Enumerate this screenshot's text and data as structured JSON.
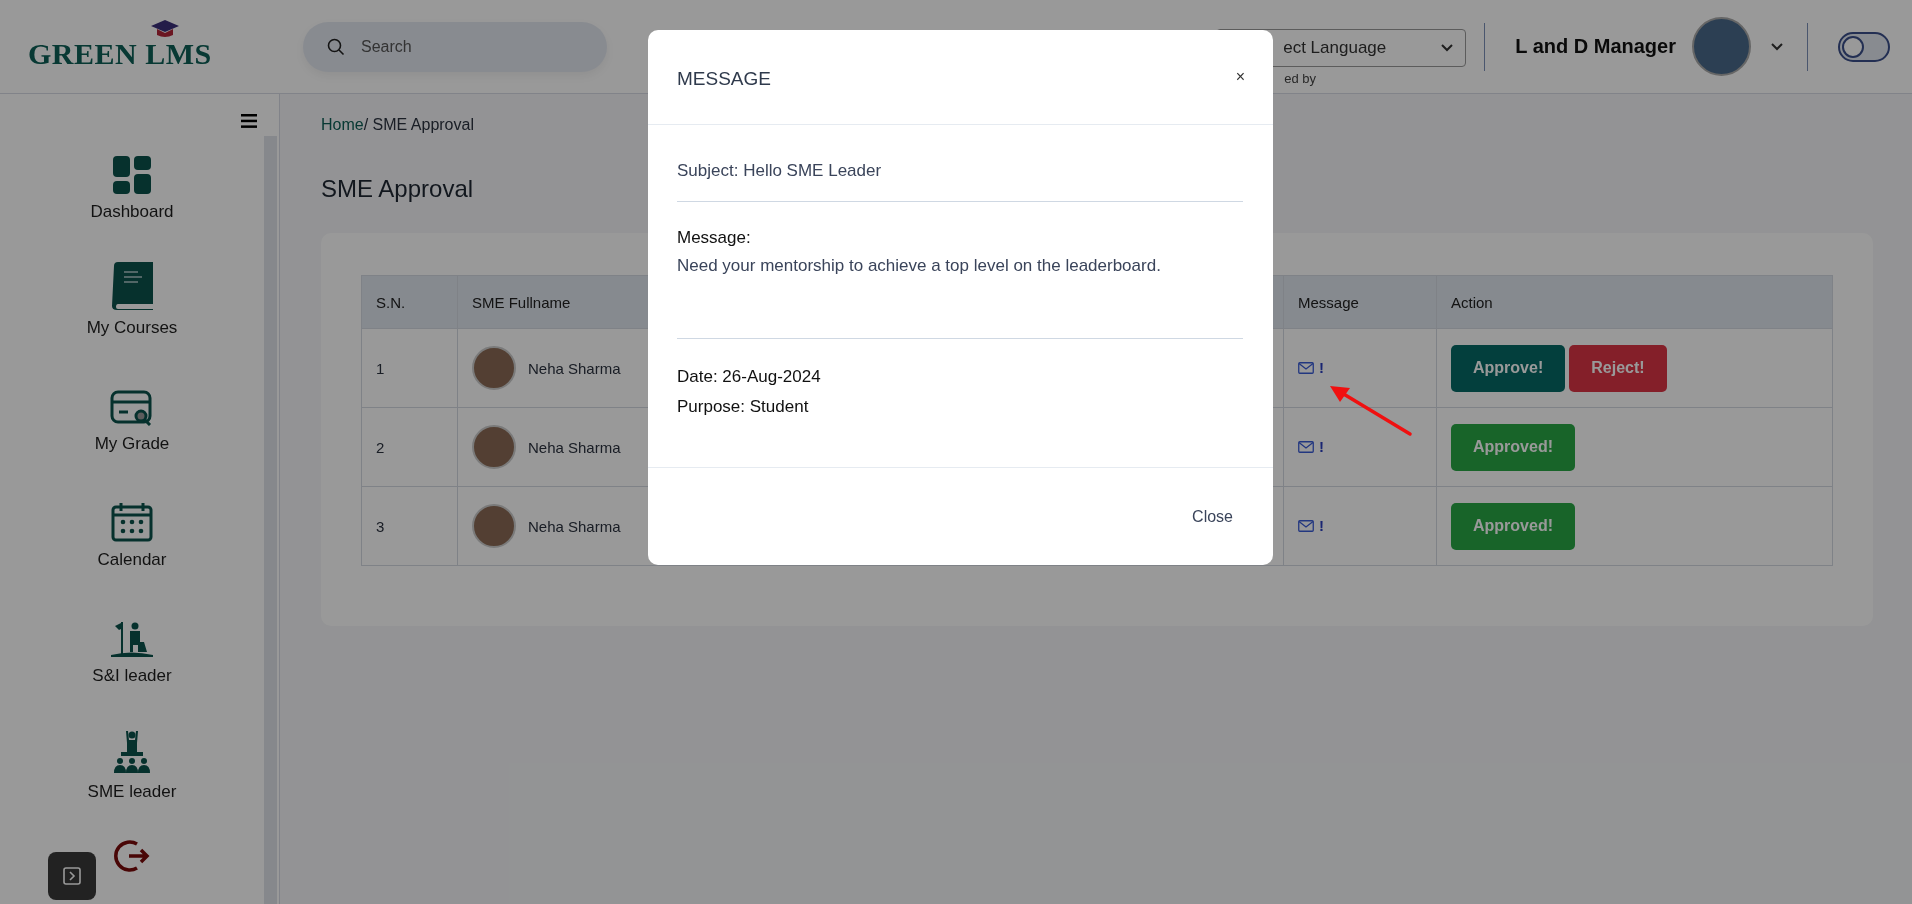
{
  "header": {
    "logo": "GREEN LMS",
    "search": {
      "placeholder": "Search"
    },
    "language_select": {
      "value": "ect Language",
      "caption": "ed by"
    },
    "user_name": "L and D Manager",
    "toggle": {
      "on": false
    }
  },
  "sidebar": {
    "items": [
      {
        "label": "Dashboard"
      },
      {
        "label": "My Courses"
      },
      {
        "label": "My Grade"
      },
      {
        "label": "Calendar"
      },
      {
        "label": "S&I leader"
      },
      {
        "label": "SME leader"
      }
    ]
  },
  "breadcrumb": {
    "home": "Home",
    "current": "/ SME Approval"
  },
  "page_title": "SME Approval",
  "table": {
    "columns": [
      "S.N.",
      "SME Fullname",
      "Message",
      "Action"
    ],
    "rows": [
      {
        "sn": "1",
        "name": "Neha Sharma",
        "message_mark": "!",
        "actions": [
          {
            "label": "Approve!",
            "kind": "approve"
          },
          {
            "label": "Reject!",
            "kind": "reject"
          }
        ]
      },
      {
        "sn": "2",
        "name": "Neha Sharma",
        "message_mark": "!",
        "actions": [
          {
            "label": "Approved!",
            "kind": "approved"
          }
        ]
      },
      {
        "sn": "3",
        "name": "Neha Sharma",
        "message_mark": "!",
        "actions": [
          {
            "label": "Approved!",
            "kind": "approved"
          }
        ]
      }
    ]
  },
  "modal": {
    "title": "MESSAGE",
    "close_symbol": "×",
    "subject": "Subject: Hello SME Leader",
    "message_label": "Message:",
    "message": "Need your mentorship to achieve a top level on the leaderboard.",
    "date": "Date: 26-Aug-2024",
    "purpose": "Purpose: Student",
    "close_button": "Close"
  }
}
